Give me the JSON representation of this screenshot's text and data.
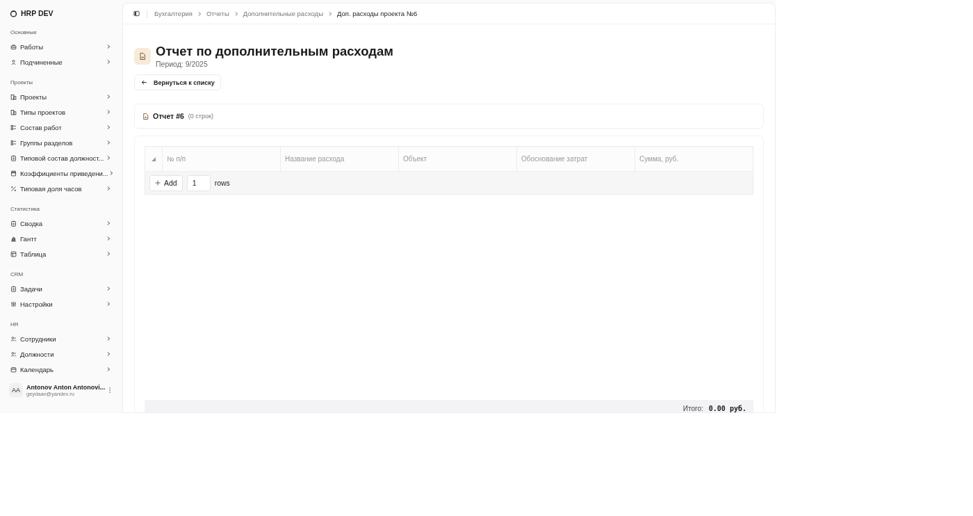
{
  "app": {
    "title": "HRP DEV"
  },
  "sidebar": {
    "sections": [
      {
        "label": "Основные",
        "items": [
          {
            "label": "Работы"
          },
          {
            "label": "Подчиненные"
          }
        ]
      },
      {
        "label": "Проекты",
        "items": [
          {
            "label": "Проекты"
          },
          {
            "label": "Типы проектов"
          },
          {
            "label": "Состав работ"
          },
          {
            "label": "Группы разделов"
          },
          {
            "label": "Типовой состав должност..."
          },
          {
            "label": "Коэффициенты приведени..."
          },
          {
            "label": "Типовая доля часов"
          }
        ]
      },
      {
        "label": "Статистика",
        "items": [
          {
            "label": "Сводка"
          },
          {
            "label": "Гантт"
          },
          {
            "label": "Таблица"
          }
        ]
      },
      {
        "label": "CRM",
        "items": [
          {
            "label": "Задачи"
          },
          {
            "label": "Настройки"
          }
        ]
      },
      {
        "label": "HR",
        "items": [
          {
            "label": "Сотрудники"
          },
          {
            "label": "Должности"
          },
          {
            "label": "Календарь"
          }
        ]
      }
    ]
  },
  "user": {
    "initials": "AA",
    "name": "Antonov Anton Antonovi...",
    "email": "geydaav@yandex.ru"
  },
  "breadcrumbs": [
    {
      "label": "Бухгалтерия",
      "selected": false
    },
    {
      "label": "Отчеты",
      "selected": false
    },
    {
      "label": "Дополнительные расходы",
      "selected": false
    },
    {
      "label": "Доп. расходы проекта №6",
      "selected": true
    }
  ],
  "page": {
    "title": "Отчет по дополнительным расходам",
    "period": "Период: 9/2025"
  },
  "back_button": "Вернуться к списку",
  "report": {
    "title": "Отчет #6",
    "count": "(0 строк)"
  },
  "table": {
    "columns": [
      "№ п/п",
      "Название расхода",
      "Объект",
      "Обоснование затрат",
      "Сумма, руб."
    ],
    "add_button": "Add",
    "rows_value": "1",
    "rows_label": "rows"
  },
  "total": {
    "label": "Итого:",
    "value": "0.00 руб."
  }
}
